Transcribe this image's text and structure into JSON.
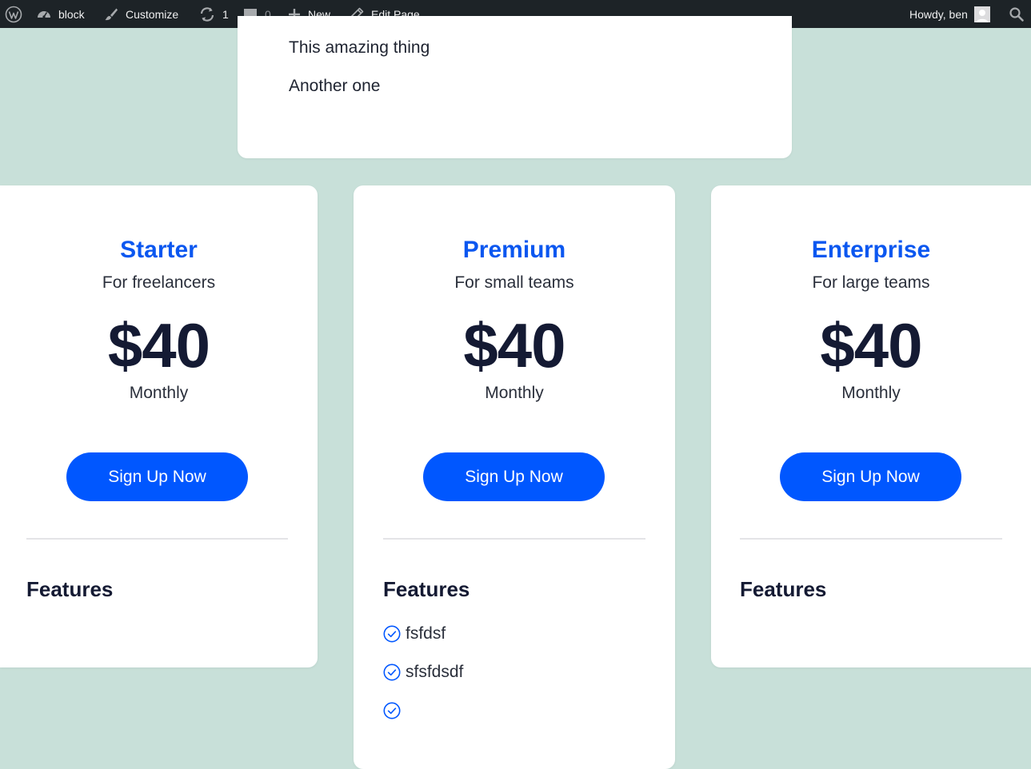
{
  "admin_bar": {
    "site_name": "block",
    "customize_label": "Customize",
    "updates_count": "1",
    "comments_count": "0",
    "new_label": "New",
    "edit_page_label": "Edit Page",
    "greeting": "Howdy, ben"
  },
  "top_card": {
    "lines": [
      "This amazing thing",
      "Another one"
    ]
  },
  "plans": [
    {
      "title": "Starter",
      "subtitle": "For freelancers",
      "price": "$40",
      "period": "Monthly",
      "button_label": "Sign Up Now",
      "features_heading": "Features",
      "features": []
    },
    {
      "title": "Premium",
      "subtitle": "For small teams",
      "price": "$40",
      "period": "Monthly",
      "button_label": "Sign Up Now",
      "features_heading": "Features",
      "features": [
        "fsfdsf",
        "sfsfdsdf",
        ""
      ]
    },
    {
      "title": "Enterprise",
      "subtitle": "For large teams",
      "price": "$40",
      "period": "Monthly",
      "button_label": "Sign Up Now",
      "features_heading": "Features",
      "features": []
    }
  ],
  "colors": {
    "page_background": "#c8e0d9",
    "admin_bar": "#1d2327",
    "accent_blue": "#0057ff",
    "title_blue": "#0b57f0",
    "price_text": "#141a33"
  },
  "icons": {
    "wp_logo": "wordpress-logo-icon",
    "site": "dashboard-icon",
    "customize": "paintbrush-icon",
    "updates": "updates-icon",
    "comments": "comment-icon",
    "new": "plus-icon",
    "edit": "pencil-icon",
    "avatar": "avatar-icon",
    "search": "search-icon",
    "feature": "check-circle-icon"
  }
}
